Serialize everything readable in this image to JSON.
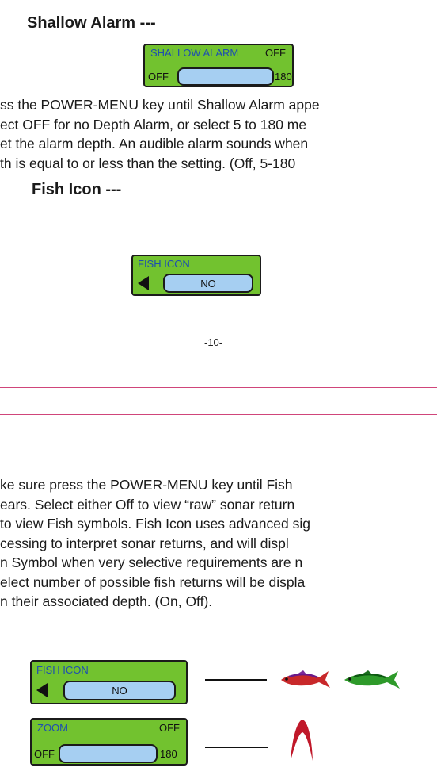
{
  "shallow_alarm": {
    "heading": "Shallow Alarm ---",
    "panel": {
      "title": "SHALLOW ALARM",
      "right_value": "OFF",
      "left_label": "OFF",
      "right_label": "180",
      "bar_value": ""
    },
    "paragraph": [
      "ss the POWER-MENU key until Shallow Alarm appe",
      "ect OFF for no Depth Alarm, or select 5 to 180 me",
      "et the alarm depth. An audible alarm sounds when",
      "th is equal to or less than the setting. (Off, 5-180"
    ]
  },
  "fish_icon": {
    "heading": "Fish Icon ---",
    "panel": {
      "title": "FISH ICON",
      "value": "NO"
    }
  },
  "page_number": "-10-",
  "fish_icon_description": {
    "paragraph": [
      "ke sure press the POWER-MENU  key until Fish",
      "ears. Select either Off to view “raw” sonar return",
      "to view Fish symbols. Fish Icon uses advanced sig",
      "cessing to interpret  sonar returns, and will displ",
      "n Symbol when very selective requirements are n",
      "elect number of possible fish returns will be displa",
      "n their associated depth. (On, Off)."
    ]
  },
  "legend": {
    "fish_panel": {
      "title": "FISH ICON",
      "value": "NO"
    },
    "zoom_panel": {
      "title": "ZOOM",
      "right_value": "OFF",
      "left_label": "OFF",
      "right_label": "180"
    },
    "fish_symbols": [
      "red-fish-icon",
      "green-fish-icon"
    ],
    "arch_symbol": "red-arch-icon"
  },
  "colors": {
    "panel_green": "#72c22f",
    "pill_blue": "#a6cff2",
    "title_blue": "#1e4fb0",
    "rule_pink": "#d0457a"
  }
}
